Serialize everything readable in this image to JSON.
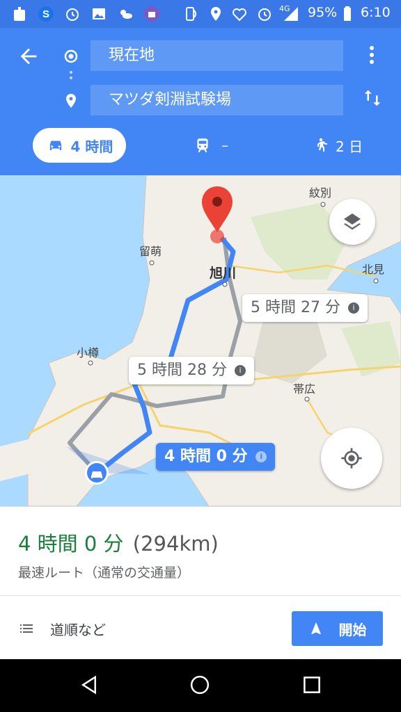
{
  "status_bar": {
    "network": "4G",
    "battery": "95%",
    "time": "6:10"
  },
  "header": {
    "origin": "現在地",
    "destination": "マツダ剣淵試験場",
    "modes": {
      "car": "4 時間",
      "transit": "–",
      "walk": "2 日"
    }
  },
  "map": {
    "place_labels": [
      "紋別",
      "留萌",
      "旭川",
      "北見",
      "小樽",
      "帯広"
    ],
    "routes": [
      {
        "label": "5 時間 27 分",
        "selected": false
      },
      {
        "label": "5 時間 28 分",
        "selected": false
      },
      {
        "label": "4 時間 0 分",
        "selected": true
      }
    ]
  },
  "summary": {
    "duration": "4 時間 0 分",
    "distance": "(294km)",
    "note": "最速ルート（通常の交通量）"
  },
  "actions": {
    "directions_label": "道順など",
    "start_label": "開始"
  },
  "colors": {
    "header_blue": "#4285f4",
    "route_blue": "#4285f4",
    "route_gray": "#9aa0a6",
    "duration_green": "#188038",
    "marker_red": "#ea4335"
  }
}
